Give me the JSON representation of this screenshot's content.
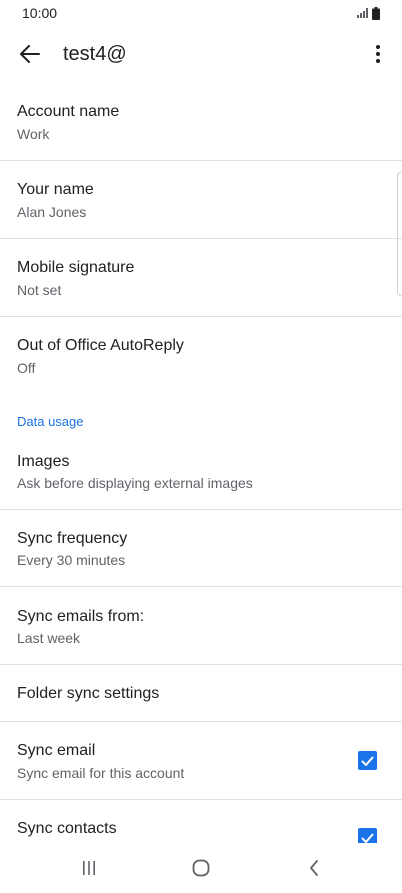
{
  "status_bar": {
    "time": "10:00",
    "signal_icon": "signal-icon",
    "battery_icon": "battery-icon"
  },
  "app_bar": {
    "title": "test4@",
    "back_icon": "arrow-back-icon",
    "more_icon": "more-vert-icon"
  },
  "settings": [
    {
      "title": "Account name",
      "subtitle": "Work"
    },
    {
      "title": "Your name",
      "subtitle": "Alan Jones"
    },
    {
      "title": "Mobile signature",
      "subtitle": "Not set"
    },
    {
      "title": "Out of Office AutoReply",
      "subtitle": "Off"
    }
  ],
  "data_usage": {
    "header": "Data usage",
    "items": [
      {
        "title": "Images",
        "subtitle": "Ask before displaying external images"
      },
      {
        "title": "Sync frequency",
        "subtitle": "Every 30 minutes"
      },
      {
        "title": "Sync emails from:",
        "subtitle": "Last week"
      },
      {
        "title": "Folder sync settings"
      },
      {
        "title": "Sync email",
        "subtitle": "Sync email for this account",
        "checked": true
      },
      {
        "title": "Sync contacts",
        "checked": true
      }
    ]
  },
  "colors": {
    "accent": "#1a73e8",
    "text": "#202124",
    "secondary_text": "#5f6368",
    "divider": "#e0e0e0"
  },
  "nav_bar": {
    "recents_icon": "recents-icon",
    "home_icon": "home-icon",
    "back_icon": "nav-back-icon"
  }
}
